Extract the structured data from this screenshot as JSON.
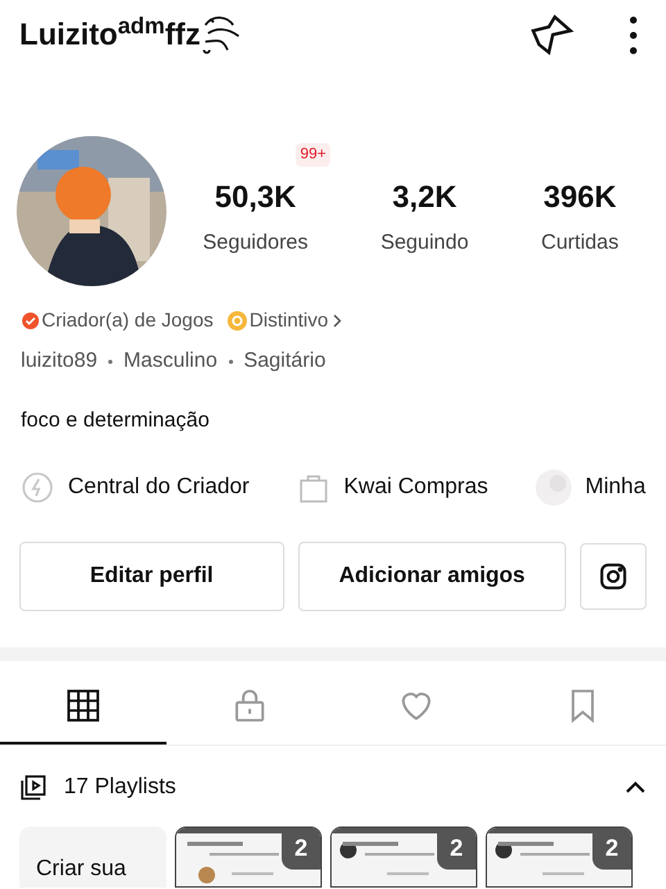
{
  "header": {
    "username": "Luizito$^{adm}$ffz"
  },
  "profile": {
    "notification_badge": "99+",
    "stats": [
      {
        "value": "50,3K",
        "label": "Seguidores"
      },
      {
        "value": "3,2K",
        "label": "Seguindo"
      },
      {
        "value": "396K",
        "label": "Curtidas"
      }
    ]
  },
  "tags": [
    {
      "kind": "creator",
      "label": "Criador(a) de Jogos"
    },
    {
      "kind": "badge",
      "label": "Distintivo"
    }
  ],
  "details": [
    "luizito89",
    "Masculino",
    "Sagitário"
  ],
  "bio": "foco e determinação",
  "shortcuts": [
    {
      "kind": "bolt",
      "label": "Central do Criador"
    },
    {
      "kind": "bag",
      "label": "Kwai Compras"
    },
    {
      "kind": "avatar",
      "label": "Minha"
    }
  ],
  "actions": [
    {
      "label": "Editar perfil"
    },
    {
      "label": "Adicionar amigos"
    }
  ],
  "tabs": [
    {
      "kind": "grid",
      "selected": true
    },
    {
      "kind": "lock",
      "selected": false
    },
    {
      "kind": "heart",
      "selected": false
    },
    {
      "kind": "bookmark",
      "selected": false
    }
  ],
  "playlists": {
    "title": "17 Playlists",
    "create": "Criar sua",
    "items": [
      {
        "count": "2"
      },
      {
        "count": "2"
      },
      {
        "count": "2"
      }
    ]
  }
}
